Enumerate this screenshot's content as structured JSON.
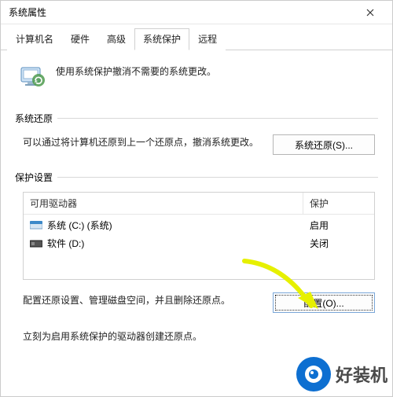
{
  "window": {
    "title": "系统属性"
  },
  "tabs": {
    "items": [
      {
        "label": "计算机名"
      },
      {
        "label": "硬件"
      },
      {
        "label": "高级"
      },
      {
        "label": "系统保护"
      },
      {
        "label": "远程"
      }
    ],
    "active_index": 3
  },
  "intro": {
    "text": "使用系统保护撤消不需要的系统更改。"
  },
  "restore": {
    "section_label": "系统还原",
    "desc": "可以通过将计算机还原到上一个还原点，撤消系统更改。",
    "button": "系统还原(S)..."
  },
  "protection": {
    "section_label": "保护设置",
    "columns": {
      "name": "可用驱动器",
      "status": "保护"
    },
    "rows": [
      {
        "icon": "drive-sys",
        "name": "系统 (C:) (系统)",
        "status": "启用"
      },
      {
        "icon": "drive",
        "name": "软件 (D:)",
        "status": "关闭"
      }
    ],
    "config_desc": "配置还原设置、管理磁盘空间，并且删除还原点。",
    "config_button": "配置(O)...",
    "create_desc": "立刻为启用系统保护的驱动器创建还原点。"
  },
  "watermark": {
    "text": "好装机"
  }
}
